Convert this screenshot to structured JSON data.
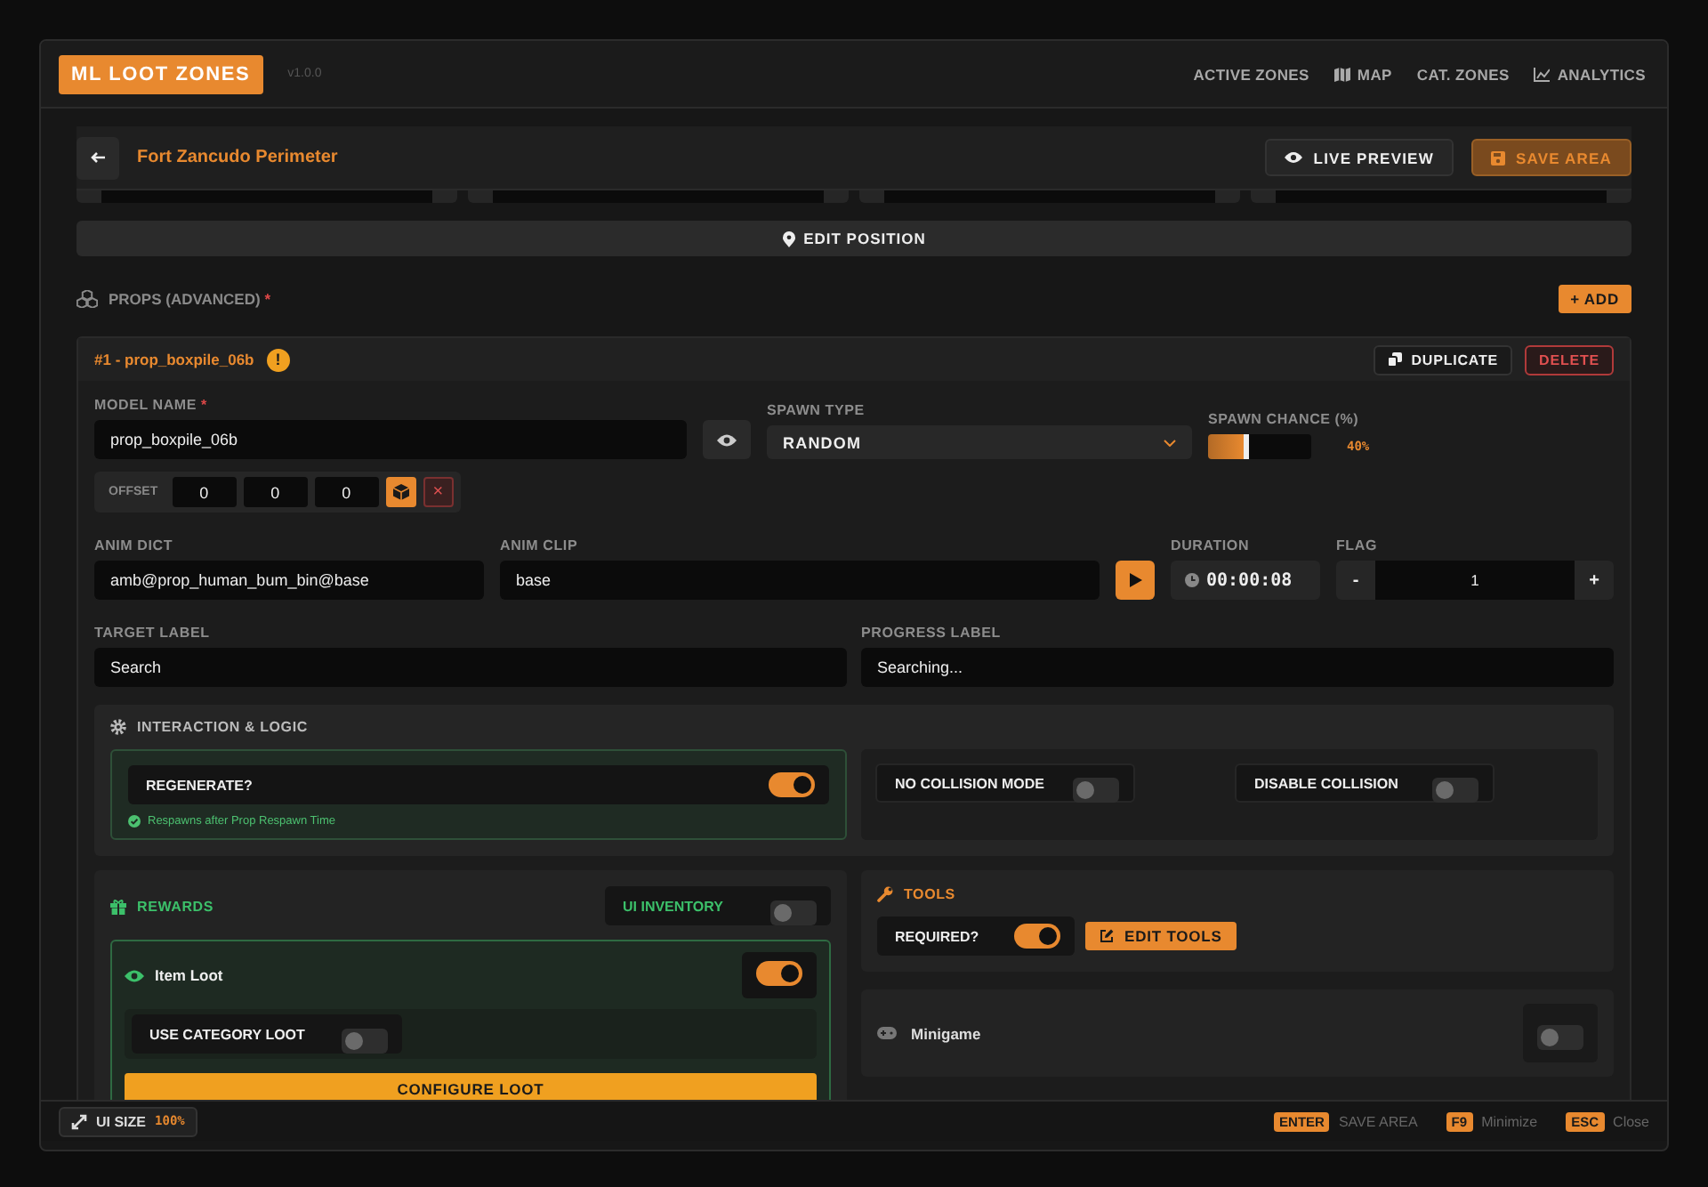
{
  "app": {
    "logo": "ML LOOT ZONES",
    "version": "v1.0.0"
  },
  "nav": [
    {
      "label": "ACTIVE ZONES"
    },
    {
      "label": "MAP"
    },
    {
      "label": "CAT. ZONES"
    },
    {
      "label": "ANALYTICS"
    }
  ],
  "area": {
    "title": "Fort Zancudo Perimeter",
    "buttons": [
      {
        "label": "LIVE PREVIEW",
        "kind": "secondary"
      },
      {
        "label": "SAVE AREA",
        "kind": "primary"
      }
    ]
  },
  "edit_position": "EDIT POSITION",
  "props": {
    "title": "PROPS (ADVANCED)",
    "required_mark": "*",
    "add": "+ ADD"
  },
  "prop": {
    "title": "#1 - prop_boxpile_06b",
    "warning": "!",
    "duplicate": "DUPLICATE",
    "delete": "DELETE",
    "model_name": {
      "label": "MODEL NAME",
      "required_mark": "*",
      "value": "prop_boxpile_06b"
    },
    "spawn_type": {
      "label": "SPAWN TYPE",
      "value": "RANDOM"
    },
    "spawn_chance": {
      "label": "SPAWN CHANCE (%)",
      "level": 0.4,
      "reading": "40%"
    },
    "offset": {
      "label": "OFFSET",
      "values": [
        "0",
        "0",
        "0"
      ],
      "clear": "×"
    },
    "anim_dict": {
      "label": "ANIM DICT",
      "value": "amb@prop_human_bum_bin@base"
    },
    "anim_clip": {
      "label": "ANIM CLIP",
      "value": "base"
    },
    "duration": {
      "label": "DURATION",
      "value": "00:00:08"
    },
    "flag": {
      "label": "FLAG",
      "value": "1",
      "minus": "-",
      "plus": "+"
    },
    "target_label": {
      "label": "TARGET LABEL",
      "value": "Search"
    },
    "progress_label": {
      "label": "PROGRESS LABEL",
      "value": "Searching..."
    }
  },
  "interaction": {
    "title": "INTERACTION & LOGIC",
    "regenerate": {
      "label": "REGENERATE?",
      "on": true,
      "note": "Respawns after Prop Respawn Time"
    },
    "toggles": [
      {
        "label": "NO COLLISION MODE",
        "on": false
      },
      {
        "label": "DISABLE COLLISION",
        "on": false
      }
    ]
  },
  "rewards": {
    "title": "REWARDS",
    "ui_inventory": {
      "label": "UI INVENTORY",
      "on": false
    },
    "item_loot": {
      "label": "Item Loot",
      "on": true
    },
    "category_loot": {
      "label": "USE CATEGORY LOOT",
      "on": false
    },
    "configure": "CONFIGURE LOOT"
  },
  "tools": {
    "title": "TOOLS",
    "required": {
      "label": "REQUIRED?",
      "on": true
    },
    "edit": "EDIT TOOLS"
  },
  "minigame": {
    "label": "Minigame",
    "on": false
  },
  "footer": {
    "ui_size": {
      "label": "UI SIZE",
      "value": "100%"
    },
    "shortcuts": [
      {
        "key": "ENTER",
        "label": "SAVE AREA"
      },
      {
        "key": "F9",
        "label": "Minimize"
      },
      {
        "key": "ESC",
        "label": "Close"
      }
    ]
  }
}
